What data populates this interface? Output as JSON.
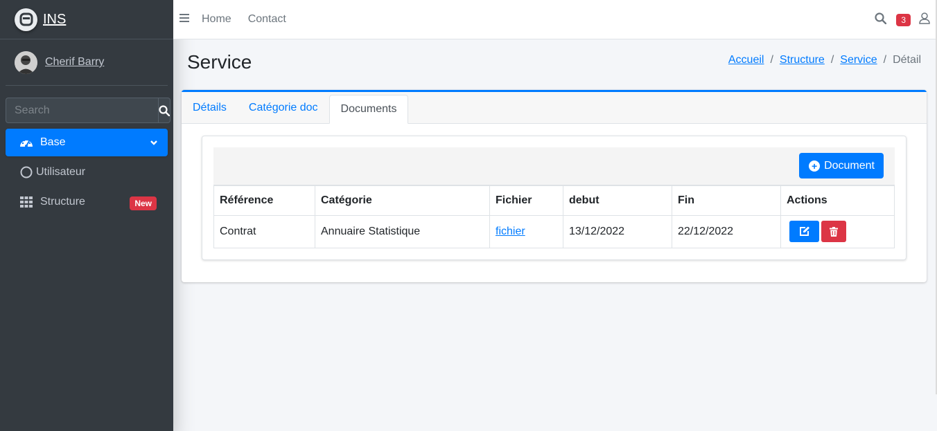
{
  "brand": {
    "name": "INS"
  },
  "user": {
    "name": "Cherif Barry"
  },
  "search": {
    "placeholder": "Search"
  },
  "sidebar": {
    "items": [
      {
        "label": "Base",
        "icon": "tachometer-icon"
      },
      {
        "label": "Utilisateur",
        "icon": "circle-icon"
      },
      {
        "label": "Structure",
        "icon": "grid-icon",
        "badge": "New"
      }
    ]
  },
  "topbar": {
    "links": [
      "Home",
      "Contact"
    ],
    "notifications": "3"
  },
  "page": {
    "title": "Service",
    "breadcrumb": [
      "Accueil",
      "Structure",
      "Service",
      "Détail"
    ]
  },
  "tabs": [
    "Détails",
    "Catégorie doc",
    "Documents"
  ],
  "toolbar": {
    "add_label": "Document"
  },
  "table": {
    "headers": [
      "Référence",
      "Catégorie",
      "Fichier",
      "debut",
      "Fin",
      "Actions"
    ],
    "rows": [
      {
        "reference": "Contrat",
        "categorie": "Annuaire Statistique",
        "fichier": "fichier",
        "debut": "13/12/2022",
        "fin": "22/12/2022"
      }
    ]
  },
  "colors": {
    "primary": "#007bff",
    "danger": "#dc3545",
    "sidebar": "#343a40"
  }
}
